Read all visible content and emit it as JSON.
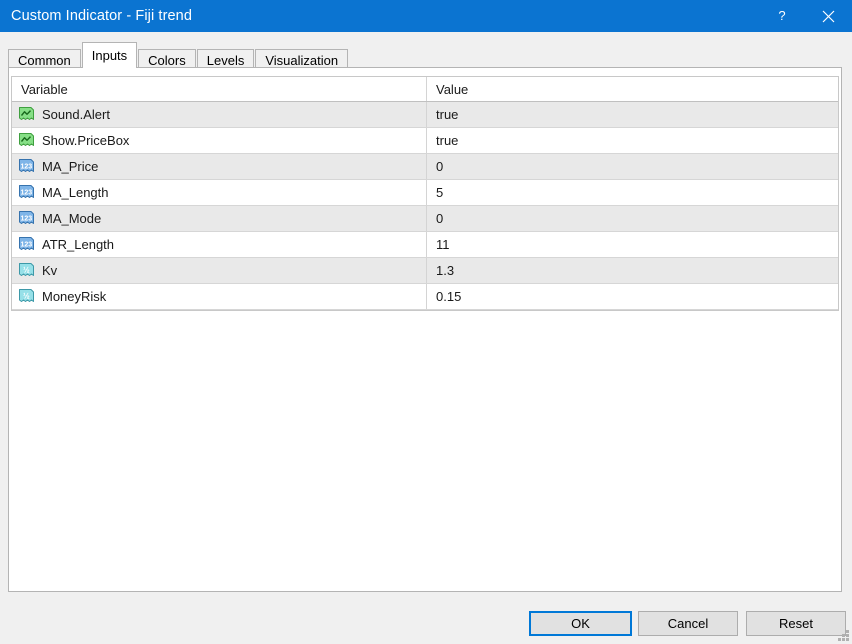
{
  "window": {
    "title": "Custom Indicator - Fiji trend",
    "accent_color": "#0b74d1",
    "help_icon": "?",
    "help_icon_name": "help-icon",
    "close_icon": "×",
    "close_icon_name": "close-icon"
  },
  "tabs": [
    {
      "label": "Common",
      "active": false
    },
    {
      "label": "Inputs",
      "active": true
    },
    {
      "label": "Colors",
      "active": false
    },
    {
      "label": "Levels",
      "active": false
    },
    {
      "label": "Visualization",
      "active": false
    }
  ],
  "table": {
    "columns": [
      "Variable",
      "Value"
    ],
    "rows": [
      {
        "icon": "bool-type-icon",
        "type": "bool",
        "variable": "Sound.Alert",
        "value": "true"
      },
      {
        "icon": "bool-type-icon",
        "type": "bool",
        "variable": "Show.PriceBox",
        "value": "true"
      },
      {
        "icon": "int-type-icon",
        "type": "int",
        "variable": "MA_Price",
        "value": "0"
      },
      {
        "icon": "int-type-icon",
        "type": "int",
        "variable": "MA_Length",
        "value": "5"
      },
      {
        "icon": "int-type-icon",
        "type": "int",
        "variable": "MA_Mode",
        "value": "0"
      },
      {
        "icon": "int-type-icon",
        "type": "int",
        "variable": "ATR_Length",
        "value": "11"
      },
      {
        "icon": "double-type-icon",
        "type": "double",
        "variable": "Kv",
        "value": "1.3"
      },
      {
        "icon": "double-type-icon",
        "type": "double",
        "variable": "MoneyRisk",
        "value": "0.15"
      }
    ]
  },
  "footer": {
    "ok_label": "OK",
    "cancel_label": "Cancel",
    "reset_label": "Reset"
  }
}
